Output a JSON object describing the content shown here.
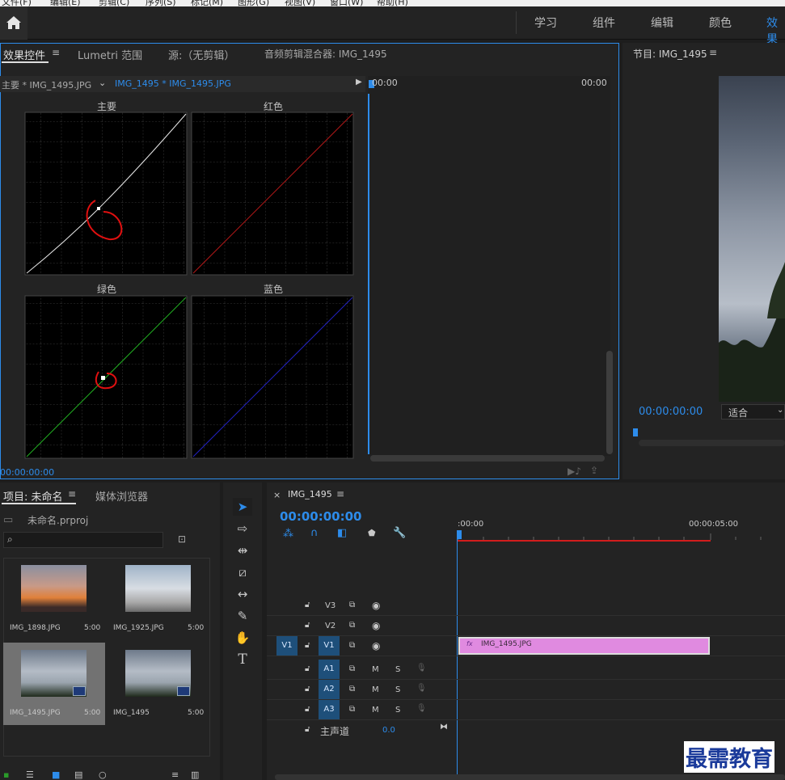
{
  "menubar": {
    "items": [
      "文件(F)",
      "编辑(E)",
      "剪辑(C)",
      "序列(S)",
      "标记(M)",
      "图形(G)",
      "视图(V)",
      "窗口(W)",
      "帮助(H)"
    ]
  },
  "workspaces": [
    "学习",
    "组件",
    "编辑",
    "颜色",
    "效果"
  ],
  "effect_panel": {
    "tabs": [
      "效果控件",
      "Lumetri 范围",
      "源:（无剪辑）",
      "音频剪辑混合器: IMG_1495"
    ],
    "source_clip": "主要 * IMG_1495.JPG",
    "sequence_clip": "IMG_1495 * IMG_1495.JPG",
    "curves": [
      "主要",
      "红色",
      "绿色",
      "蓝色"
    ],
    "mini_timeline_start": "00:00",
    "mini_timeline_end": "00:00",
    "timecode": "00:00:00:00"
  },
  "program_monitor": {
    "title": "节目: IMG_1495",
    "timecode": "00:00:00:00",
    "fit": "适合"
  },
  "project_panel": {
    "tabs": [
      "项目: 未命名",
      "媒体浏览器"
    ],
    "project_file": "未命名.prproj",
    "items": [
      {
        "name": "IMG_1898.JPG",
        "duration": "5:00"
      },
      {
        "name": "IMG_1925.JPG",
        "duration": "5:00"
      },
      {
        "name": "IMG_1495.JPG",
        "duration": "5:00"
      },
      {
        "name": "IMG_1495",
        "duration": "5:00"
      }
    ]
  },
  "timeline": {
    "sequence_name": "IMG_1495",
    "timecode": "00:00:00:00",
    "ruler_start": ":00:00",
    "ruler_mid": "00:00:05:00",
    "video_tracks": [
      "V3",
      "V2",
      "V1"
    ],
    "source_track": "V1",
    "audio_tracks": [
      "A1",
      "A2",
      "A3"
    ],
    "master_label": "主声道",
    "master_value": "0.0",
    "clip_label": "IMG_1495.JPG",
    "m_label": "M",
    "s_label": "S"
  },
  "watermark": "最需教育",
  "colors": {
    "accent": "#2d8ceb",
    "clip": "#e08ae0",
    "annotation": "#e01010"
  }
}
